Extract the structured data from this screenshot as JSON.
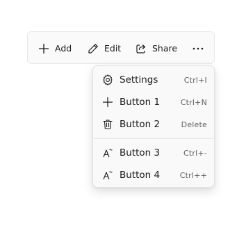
{
  "command_bar": {
    "add_label": "Add",
    "edit_label": "Edit",
    "share_label": "Share",
    "add_icon": "plus-icon",
    "edit_icon": "pencil-icon",
    "share_icon": "share-icon",
    "more_icon": "more-horizontal-icon"
  },
  "menu": {
    "items": [
      {
        "label": "Settings",
        "shortcut": "Ctrl+I",
        "icon": "gear-icon"
      },
      {
        "label": "Button 1",
        "shortcut": "Ctrl+N",
        "icon": "plus-icon"
      },
      {
        "label": "Button 2",
        "shortcut": "Delete",
        "icon": "trash-icon"
      },
      {
        "label": "Button 3",
        "shortcut": "Ctrl+-",
        "icon": "font-decrease-icon"
      },
      {
        "label": "Button 4",
        "shortcut": "Ctrl++",
        "icon": "font-increase-icon"
      }
    ]
  },
  "colors": {
    "text": "#1a1a1a",
    "shortcut_text": "#5f5f5f",
    "bar_background": "#fafafa",
    "menu_background": "#f9f9f9"
  }
}
